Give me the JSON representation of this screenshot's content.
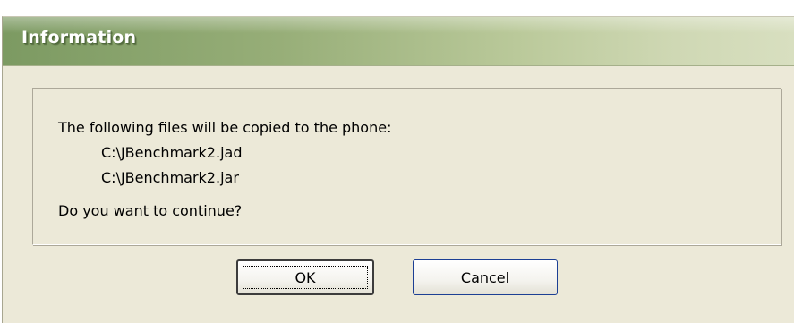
{
  "dialog": {
    "title": "Information",
    "message": {
      "intro": "The following files will be copied to the phone:",
      "files": [
        "C:\\JBenchmark2.jad",
        "C:\\JBenchmark2.jar"
      ],
      "question": "Do you want to continue?"
    },
    "buttons": {
      "ok_label": "OK",
      "cancel_label": "Cancel"
    }
  },
  "colors": {
    "titlebar_start": "#7c9a62",
    "titlebar_end": "#d8dfc0",
    "dialog_background": "#ece9d8"
  }
}
